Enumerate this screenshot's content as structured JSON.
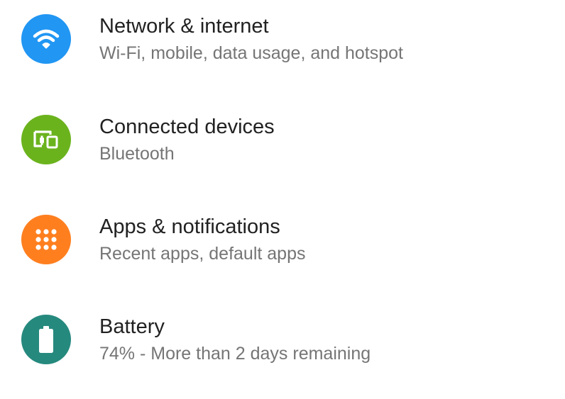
{
  "settings": {
    "items": [
      {
        "title": "Network & internet",
        "summary": "Wi-Fi, mobile, data usage, and hotspot",
        "icon": "wifi-icon",
        "icon_color": "#2196F3"
      },
      {
        "title": "Connected devices",
        "summary": "Bluetooth",
        "icon": "devices-icon",
        "icon_color": "#6BB31D"
      },
      {
        "title": "Apps & notifications",
        "summary": "Recent apps, default apps",
        "icon": "apps-grid-icon",
        "icon_color": "#FF7F1F"
      },
      {
        "title": "Battery",
        "summary": "74% - More than 2 days remaining",
        "icon": "battery-icon",
        "icon_color": "#26897E",
        "battery_level": 0.74
      }
    ]
  }
}
